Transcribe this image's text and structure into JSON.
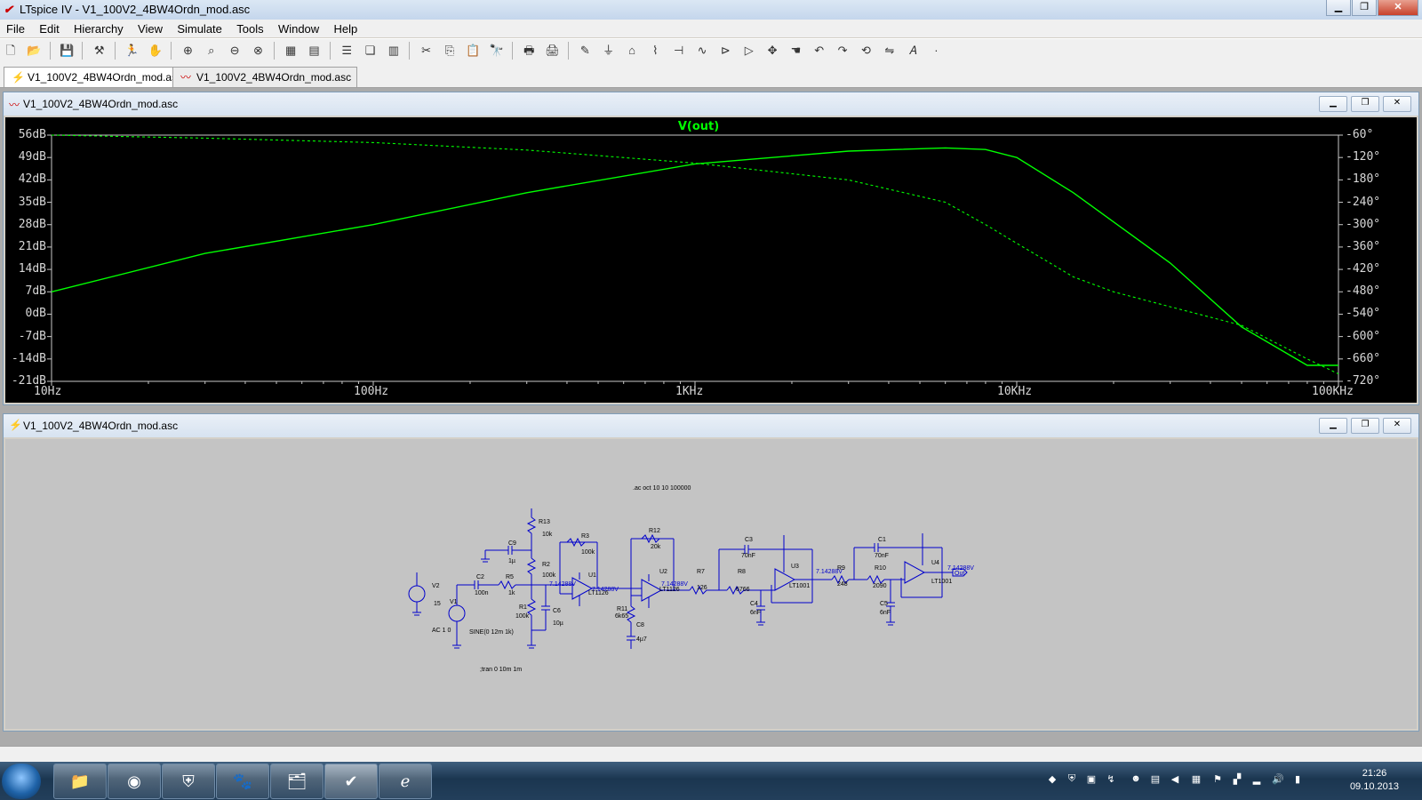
{
  "window": {
    "title": "LTspice IV - V1_100V2_4BW4Ordn_mod.asc"
  },
  "menu": [
    "File",
    "Edit",
    "Hierarchy",
    "View",
    "Simulate",
    "Tools",
    "Window",
    "Help"
  ],
  "tabs": [
    {
      "label": "V1_100V2_4BW4Ordn_mod.asc",
      "type": "schematic"
    },
    {
      "label": "V1_100V2_4BW4Ordn_mod.asc",
      "type": "waveform"
    }
  ],
  "plot_window": {
    "title": "V1_100V2_4BW4Ordn_mod.asc"
  },
  "schematic_window": {
    "title": "V1_100V2_4BW4Ordn_mod.asc"
  },
  "colors": {
    "trace": "#00ff00",
    "plot_bg": "#000000",
    "schematic_bg": "#c4c4c4",
    "component": "#0000cc"
  },
  "chart_data": {
    "type": "line",
    "title": "V(out)",
    "xscale": "log",
    "xlim": [
      10,
      100000
    ],
    "x_ticks": [
      "10Hz",
      "100Hz",
      "1KHz",
      "10KHz",
      "100KHz"
    ],
    "y_left_ticks": [
      "56dB",
      "49dB",
      "42dB",
      "35dB",
      "28dB",
      "21dB",
      "14dB",
      "7dB",
      "0dB",
      "-7dB",
      "-14dB",
      "-21dB"
    ],
    "y_left_lim": [
      -21,
      56
    ],
    "y_right_ticks": [
      "-60°",
      "-120°",
      "-180°",
      "-240°",
      "-300°",
      "-360°",
      "-420°",
      "-480°",
      "-540°",
      "-600°",
      "-660°",
      "-720°"
    ],
    "y_right_lim": [
      -720,
      -60
    ],
    "series": [
      {
        "x": [
          10,
          30,
          100,
          300,
          1000,
          3000,
          6000,
          8000,
          10000,
          15000,
          30000,
          50000,
          80000,
          100000
        ],
        "values": [
          7,
          19,
          28,
          38,
          47,
          51,
          52,
          51.5,
          49,
          38,
          16,
          -4,
          -16,
          -16
        ]
      },
      {
        "x": [
          10,
          30,
          100,
          300,
          1000,
          3000,
          6000,
          8000,
          10000,
          15000,
          20000,
          30000,
          50000,
          80000,
          100000
        ],
        "values_deg": [
          -60,
          -68,
          -80,
          -100,
          -135,
          -180,
          -240,
          -300,
          -350,
          -440,
          -480,
          -520,
          -570,
          -660,
          -700
        ]
      }
    ]
  },
  "schematic": {
    "labels": [
      {
        "t": ".ac oct 10 10 100000"
      },
      {
        "t": ";tran 0 10m 1m"
      },
      {
        "t": "AC 1 0"
      },
      {
        "t": "SINE(0 12m 1k)"
      },
      {
        "t": "V2"
      },
      {
        "t": "15"
      },
      {
        "t": "V1"
      },
      {
        "t": "C2"
      },
      {
        "t": "100n"
      },
      {
        "t": "R5"
      },
      {
        "t": "1k"
      },
      {
        "t": "C9"
      },
      {
        "t": "1µ"
      },
      {
        "t": "R13"
      },
      {
        "t": "10k"
      },
      {
        "t": "R2"
      },
      {
        "t": "100k"
      },
      {
        "t": "R1"
      },
      {
        "t": "100k"
      },
      {
        "t": "C6"
      },
      {
        "t": "10µ"
      },
      {
        "t": "R3"
      },
      {
        "t": "100k"
      },
      {
        "t": "U1"
      },
      {
        "t": "LT1126"
      },
      {
        "t": "7.14288V"
      },
      {
        "t": "7.14288V"
      },
      {
        "t": "R12"
      },
      {
        "t": "20k"
      },
      {
        "t": "U2"
      },
      {
        "t": "LT1126"
      },
      {
        "t": "7.14288V"
      },
      {
        "t": "R11"
      },
      {
        "t": "6k65"
      },
      {
        "t": "C8"
      },
      {
        "t": "4µ7"
      },
      {
        "t": "R7"
      },
      {
        "t": "126"
      },
      {
        "t": "C3"
      },
      {
        "t": "70nF"
      },
      {
        "t": "R8"
      },
      {
        "t": "6766"
      },
      {
        "t": "C4"
      },
      {
        "t": "6nF"
      },
      {
        "t": "U3"
      },
      {
        "t": "LT1001"
      },
      {
        "t": "7.14288V"
      },
      {
        "t": "R9"
      },
      {
        "t": "248"
      },
      {
        "t": "C1"
      },
      {
        "t": "70nF"
      },
      {
        "t": "R10"
      },
      {
        "t": "2090"
      },
      {
        "t": "C5"
      },
      {
        "t": "6nF"
      },
      {
        "t": "U4"
      },
      {
        "t": "LT1001"
      },
      {
        "t": "7.14288V"
      },
      {
        "t": "Out"
      }
    ]
  },
  "taskbar": {
    "time": "21:26",
    "date": "09.10.2013"
  }
}
